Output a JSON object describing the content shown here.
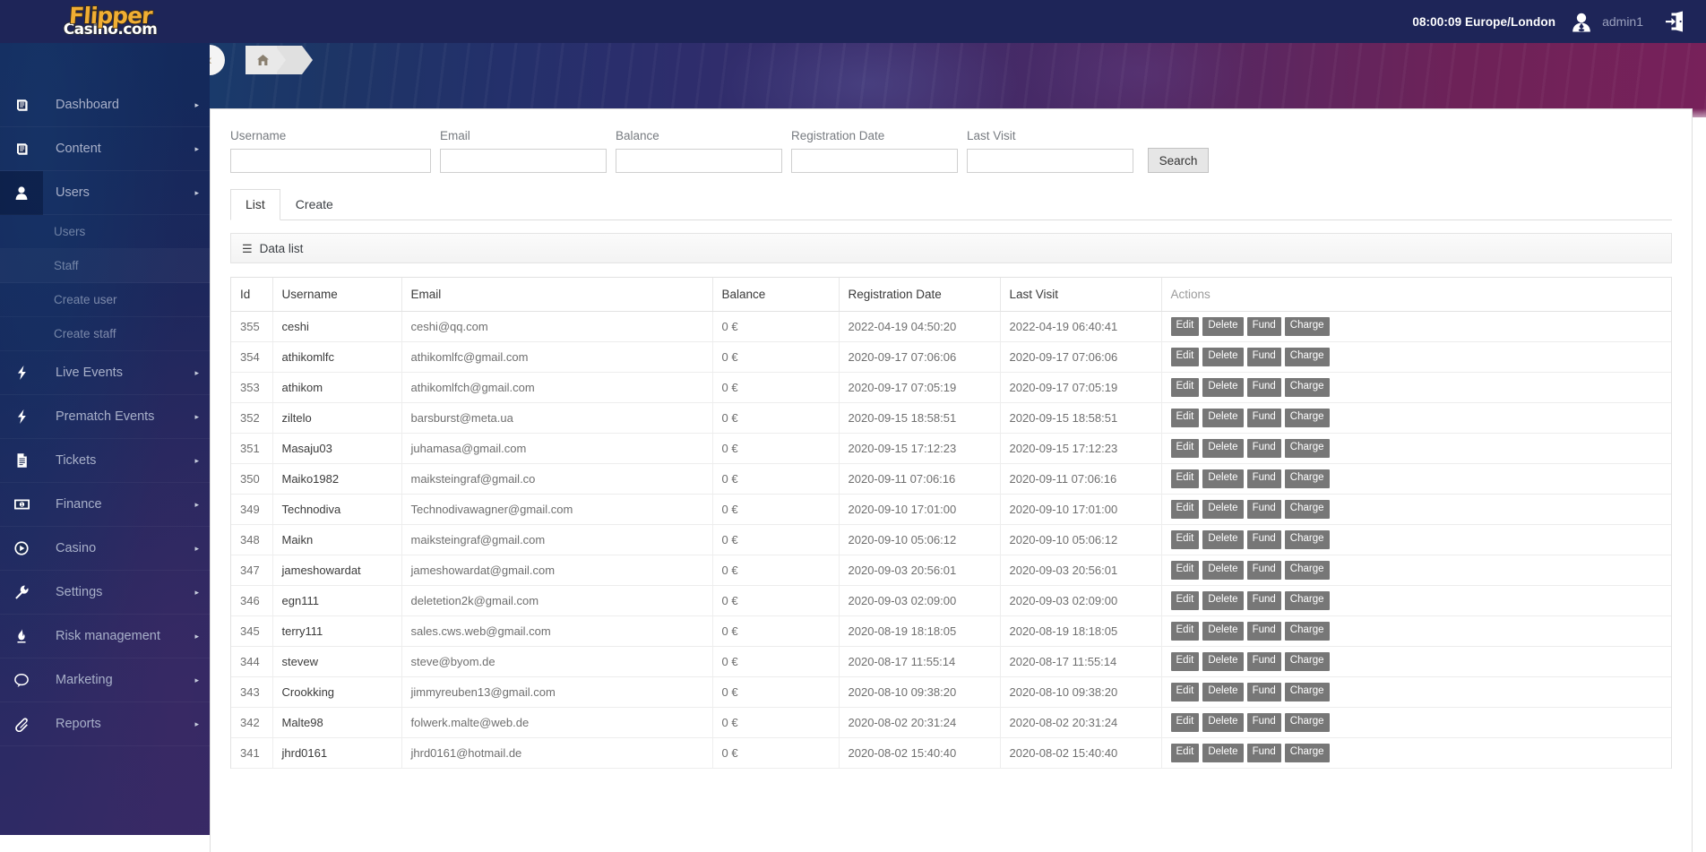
{
  "topbar": {
    "logo_top": "Flipper",
    "logo_bottom": "Casino.com",
    "clock": "08:00:09 Europe/London",
    "user": "admin1",
    "avatar_icon": "user-avatar-icon",
    "logout_icon": "logout-icon"
  },
  "breadcrumb": {
    "collapse_icon": "chevron-left-icon",
    "home_icon": "home-icon"
  },
  "sidebar": {
    "items": [
      {
        "label": "Dashboard",
        "icon": "book-icon",
        "caret": "▸",
        "active": false
      },
      {
        "label": "Content",
        "icon": "book-icon",
        "caret": "▸",
        "active": false
      },
      {
        "label": "Users",
        "icon": "user-icon",
        "caret": "▸",
        "active": true
      },
      {
        "label": "Live Events",
        "icon": "bolt-icon",
        "caret": "▸",
        "active": false
      },
      {
        "label": "Prematch Events",
        "icon": "bolt-icon",
        "caret": "▸",
        "active": false
      },
      {
        "label": "Tickets",
        "icon": "file-icon",
        "caret": "▸",
        "active": false
      },
      {
        "label": "Finance",
        "icon": "money-icon",
        "caret": "▸",
        "active": false
      },
      {
        "label": "Casino",
        "icon": "play-circle-icon",
        "caret": "▸",
        "active": false
      },
      {
        "label": "Settings",
        "icon": "wrench-icon",
        "caret": "▸",
        "active": false
      },
      {
        "label": "Risk management",
        "icon": "flame-icon",
        "caret": "▸",
        "active": false
      },
      {
        "label": "Marketing",
        "icon": "chat-icon",
        "caret": "▸",
        "active": false
      },
      {
        "label": "Reports",
        "icon": "paperclip-icon",
        "caret": "▸",
        "active": false
      }
    ],
    "users_submenu": [
      {
        "label": "Users",
        "selected": false
      },
      {
        "label": "Staff",
        "selected": true
      },
      {
        "label": "Create user",
        "selected": false
      },
      {
        "label": "Create staff",
        "selected": false
      }
    ]
  },
  "search": {
    "fields": [
      {
        "label": "Username",
        "value": "",
        "placeholder": ""
      },
      {
        "label": "Email",
        "value": "",
        "placeholder": ""
      },
      {
        "label": "Balance",
        "value": "",
        "placeholder": ""
      },
      {
        "label": "Registration Date",
        "value": "",
        "placeholder": ""
      },
      {
        "label": "Last Visit",
        "value": "",
        "placeholder": ""
      }
    ],
    "button": "Search"
  },
  "tabs": [
    {
      "label": "List",
      "active": true
    },
    {
      "label": "Create",
      "active": false
    }
  ],
  "datalist": {
    "icon": "hamburger-icon",
    "title": "Data list"
  },
  "table": {
    "columns": [
      "Id",
      "Username",
      "Email",
      "Balance",
      "Registration Date",
      "Last Visit",
      "Actions"
    ],
    "actions": [
      "Edit",
      "Delete",
      "Fund",
      "Charge"
    ],
    "rows": [
      {
        "id": "355",
        "username": "ceshi",
        "email": "ceshi@qq.com",
        "balance": "0 €",
        "registration": "2022-04-19 04:50:20",
        "last_visit": "2022-04-19 06:40:41"
      },
      {
        "id": "354",
        "username": "athikomlfc",
        "email": "athikomlfc@gmail.com",
        "balance": "0 €",
        "registration": "2020-09-17 07:06:06",
        "last_visit": "2020-09-17 07:06:06"
      },
      {
        "id": "353",
        "username": "athikom",
        "email": "athikomlfch@gmail.com",
        "balance": "0 €",
        "registration": "2020-09-17 07:05:19",
        "last_visit": "2020-09-17 07:05:19"
      },
      {
        "id": "352",
        "username": "ziltelo",
        "email": "barsburst@meta.ua",
        "balance": "0 €",
        "registration": "2020-09-15 18:58:51",
        "last_visit": "2020-09-15 18:58:51"
      },
      {
        "id": "351",
        "username": "Masaju03",
        "email": "juhamasa@gmail.com",
        "balance": "0 €",
        "registration": "2020-09-15 17:12:23",
        "last_visit": "2020-09-15 17:12:23"
      },
      {
        "id": "350",
        "username": "Maiko1982",
        "email": "maiksteingraf@gmail.co",
        "balance": "0 €",
        "registration": "2020-09-11 07:06:16",
        "last_visit": "2020-09-11 07:06:16"
      },
      {
        "id": "349",
        "username": "Technodiva",
        "email": "Technodivawagner@gmail.com",
        "balance": "0 €",
        "registration": "2020-09-10 17:01:00",
        "last_visit": "2020-09-10 17:01:00"
      },
      {
        "id": "348",
        "username": "Maikn",
        "email": "maiksteingraf@gmail.com",
        "balance": "0 €",
        "registration": "2020-09-10 05:06:12",
        "last_visit": "2020-09-10 05:06:12"
      },
      {
        "id": "347",
        "username": "jameshowardat",
        "email": "jameshowardat@gmail.com",
        "balance": "0 €",
        "registration": "2020-09-03 20:56:01",
        "last_visit": "2020-09-03 20:56:01"
      },
      {
        "id": "346",
        "username": "egn111",
        "email": "deletetion2k@gmail.com",
        "balance": "0 €",
        "registration": "2020-09-03 02:09:00",
        "last_visit": "2020-09-03 02:09:00"
      },
      {
        "id": "345",
        "username": "terry111",
        "email": "sales.cws.web@gmail.com",
        "balance": "0 €",
        "registration": "2020-08-19 18:18:05",
        "last_visit": "2020-08-19 18:18:05"
      },
      {
        "id": "344",
        "username": "stevew",
        "email": "steve@byom.de",
        "balance": "0 €",
        "registration": "2020-08-17 11:55:14",
        "last_visit": "2020-08-17 11:55:14"
      },
      {
        "id": "343",
        "username": "Crookking",
        "email": "jimmyreuben13@gmail.com",
        "balance": "0 €",
        "registration": "2020-08-10 09:38:20",
        "last_visit": "2020-08-10 09:38:20"
      },
      {
        "id": "342",
        "username": "Malte98",
        "email": "folwerk.malte@web.de",
        "balance": "0 €",
        "registration": "2020-08-02 20:31:24",
        "last_visit": "2020-08-02 20:31:24"
      },
      {
        "id": "341",
        "username": "jhrd0161",
        "email": "jhrd0161@hotmail.de",
        "balance": "0 €",
        "registration": "2020-08-02 15:40:40",
        "last_visit": "2020-08-02 15:40:40"
      }
    ]
  },
  "colors": {
    "topbar_bg": "#1e2558",
    "sidebar_bg": "#162a5c",
    "logo_gold": "#f0ae34",
    "action_button": "#777777",
    "banner_start": "#1a3a6b",
    "banner_end": "#77215a"
  }
}
